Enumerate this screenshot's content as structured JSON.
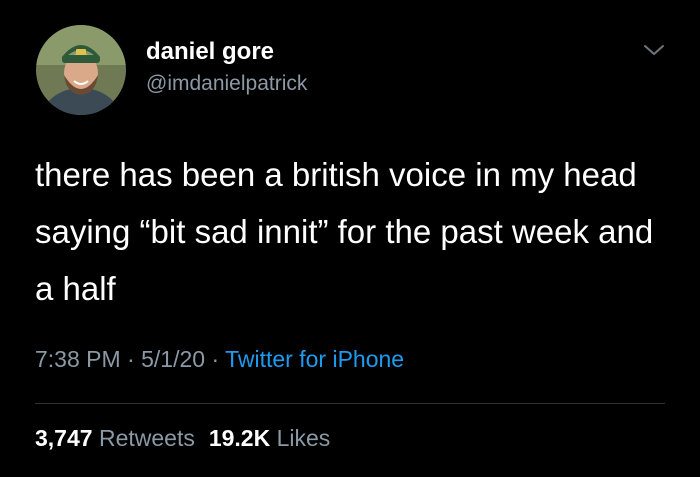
{
  "user": {
    "display_name": "daniel gore",
    "handle": "@imdanielpatrick"
  },
  "icons": {
    "menu": "chevron-down-icon",
    "avatar": "avatar"
  },
  "tweet": {
    "text": "there has been a british voice in my head saying “bit sad innit” for the past week and a half"
  },
  "meta": {
    "time": "7:38 PM",
    "separator": "·",
    "date": "5/1/20",
    "source": "Twitter for iPhone"
  },
  "stats": {
    "retweets_count": "3,747",
    "retweets_label": "Retweets",
    "likes_count": "19.2K",
    "likes_label": "Likes"
  },
  "colors": {
    "background": "#000000",
    "primary_text": "#ffffff",
    "secondary_text": "#8b98a5",
    "link": "#1d9bf0",
    "divider": "#2f3336"
  }
}
